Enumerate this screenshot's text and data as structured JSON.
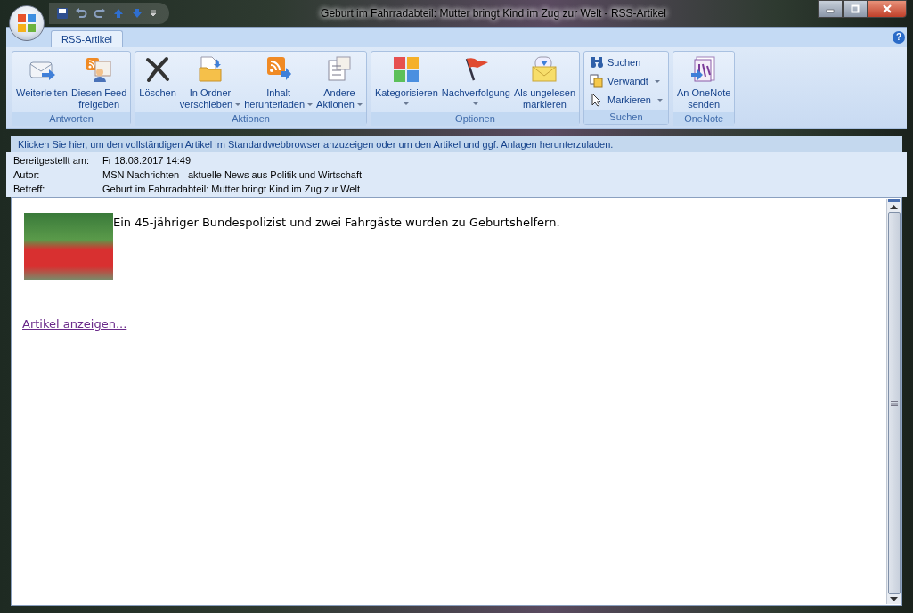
{
  "window": {
    "title": "Geburt im Fahrradabteil: Mutter bringt Kind im Zug zur Welt - RSS-Artikel"
  },
  "ribbon": {
    "tabs": [
      {
        "label": "RSS-Artikel",
        "selected": true
      }
    ],
    "help": "?",
    "groups": [
      {
        "label": "Antworten",
        "buttons": [
          {
            "kind": "large",
            "lines": [
              "Weiterleiten"
            ],
            "dropdown": false
          },
          {
            "kind": "large",
            "lines": [
              "Diesen Feed",
              "freigeben"
            ],
            "dropdown": false
          }
        ]
      },
      {
        "label": "Aktionen",
        "buttons": [
          {
            "kind": "large",
            "lines": [
              "Löschen"
            ],
            "dropdown": false
          },
          {
            "kind": "large",
            "lines": [
              "In Ordner",
              "verschieben"
            ],
            "dropdown": true
          },
          {
            "kind": "large",
            "lines": [
              "Inhalt",
              "herunterladen"
            ],
            "dropdown": true
          },
          {
            "kind": "large",
            "lines": [
              "Andere",
              "Aktionen"
            ],
            "dropdown": true
          }
        ]
      },
      {
        "label": "Optionen",
        "buttons": [
          {
            "kind": "large",
            "lines": [
              "Kategorisieren"
            ],
            "dropdown": true
          },
          {
            "kind": "large",
            "lines": [
              "Nachverfolgung"
            ],
            "dropdown": true
          },
          {
            "kind": "large",
            "lines": [
              "Als ungelesen",
              "markieren"
            ],
            "dropdown": false
          }
        ]
      },
      {
        "label": "Suchen",
        "buttons": [
          {
            "kind": "small",
            "lines": [
              "Suchen"
            ],
            "dropdown": false
          },
          {
            "kind": "small",
            "lines": [
              "Verwandt"
            ],
            "dropdown": true
          },
          {
            "kind": "small",
            "lines": [
              "Markieren"
            ],
            "dropdown": true
          }
        ]
      },
      {
        "label": "OneNote",
        "buttons": [
          {
            "kind": "large",
            "lines": [
              "An OneNote",
              "senden"
            ],
            "dropdown": false
          }
        ]
      }
    ]
  },
  "infobar": {
    "text": "Klicken Sie hier, um den vollständigen Artikel im Standardwebbrowser anzuzeigen oder um den Artikel und ggf. Anlagen herunterzuladen."
  },
  "headers": [
    {
      "label": "Bereitgestellt am:",
      "value": "Fr 18.08.2017 14:49"
    },
    {
      "label": "Autor:",
      "value": "MSN Nachrichten - aktuelle News aus Politik und Wirtschaft"
    },
    {
      "label": "Betreff:",
      "value": "Geburt im Fahrradabteil: Mutter bringt Kind im Zug zur Welt"
    }
  ],
  "article": {
    "text": "Ein 45-jähriger Bundespolizist und zwei Fahrgäste wurden zu Geburtshelfern.",
    "link": "Artikel anzeigen..."
  }
}
